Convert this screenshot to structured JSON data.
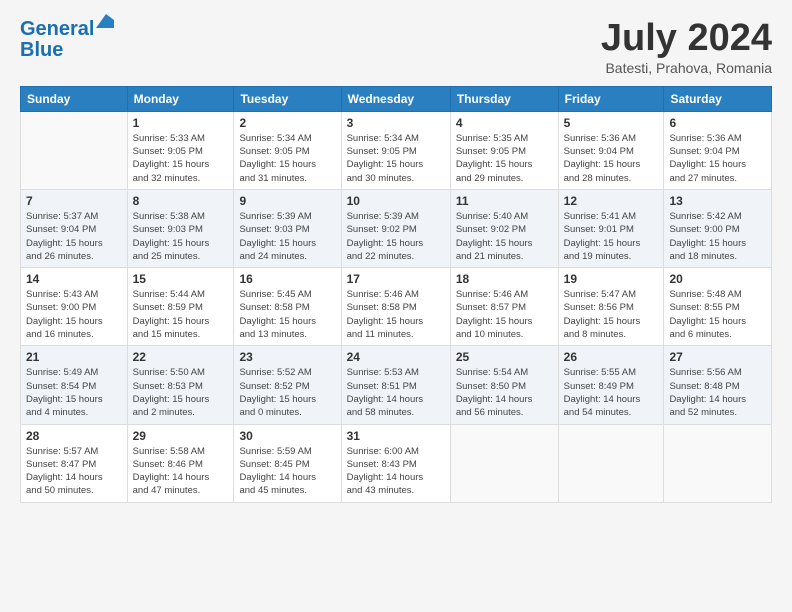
{
  "header": {
    "logo_line1": "General",
    "logo_line2": "Blue",
    "month_year": "July 2024",
    "location": "Batesti, Prahova, Romania"
  },
  "days_of_week": [
    "Sunday",
    "Monday",
    "Tuesday",
    "Wednesday",
    "Thursday",
    "Friday",
    "Saturday"
  ],
  "weeks": [
    [
      {
        "day": "",
        "info": ""
      },
      {
        "day": "1",
        "info": "Sunrise: 5:33 AM\nSunset: 9:05 PM\nDaylight: 15 hours\nand 32 minutes."
      },
      {
        "day": "2",
        "info": "Sunrise: 5:34 AM\nSunset: 9:05 PM\nDaylight: 15 hours\nand 31 minutes."
      },
      {
        "day": "3",
        "info": "Sunrise: 5:34 AM\nSunset: 9:05 PM\nDaylight: 15 hours\nand 30 minutes."
      },
      {
        "day": "4",
        "info": "Sunrise: 5:35 AM\nSunset: 9:05 PM\nDaylight: 15 hours\nand 29 minutes."
      },
      {
        "day": "5",
        "info": "Sunrise: 5:36 AM\nSunset: 9:04 PM\nDaylight: 15 hours\nand 28 minutes."
      },
      {
        "day": "6",
        "info": "Sunrise: 5:36 AM\nSunset: 9:04 PM\nDaylight: 15 hours\nand 27 minutes."
      }
    ],
    [
      {
        "day": "7",
        "info": "Sunrise: 5:37 AM\nSunset: 9:04 PM\nDaylight: 15 hours\nand 26 minutes."
      },
      {
        "day": "8",
        "info": "Sunrise: 5:38 AM\nSunset: 9:03 PM\nDaylight: 15 hours\nand 25 minutes."
      },
      {
        "day": "9",
        "info": "Sunrise: 5:39 AM\nSunset: 9:03 PM\nDaylight: 15 hours\nand 24 minutes."
      },
      {
        "day": "10",
        "info": "Sunrise: 5:39 AM\nSunset: 9:02 PM\nDaylight: 15 hours\nand 22 minutes."
      },
      {
        "day": "11",
        "info": "Sunrise: 5:40 AM\nSunset: 9:02 PM\nDaylight: 15 hours\nand 21 minutes."
      },
      {
        "day": "12",
        "info": "Sunrise: 5:41 AM\nSunset: 9:01 PM\nDaylight: 15 hours\nand 19 minutes."
      },
      {
        "day": "13",
        "info": "Sunrise: 5:42 AM\nSunset: 9:00 PM\nDaylight: 15 hours\nand 18 minutes."
      }
    ],
    [
      {
        "day": "14",
        "info": "Sunrise: 5:43 AM\nSunset: 9:00 PM\nDaylight: 15 hours\nand 16 minutes."
      },
      {
        "day": "15",
        "info": "Sunrise: 5:44 AM\nSunset: 8:59 PM\nDaylight: 15 hours\nand 15 minutes."
      },
      {
        "day": "16",
        "info": "Sunrise: 5:45 AM\nSunset: 8:58 PM\nDaylight: 15 hours\nand 13 minutes."
      },
      {
        "day": "17",
        "info": "Sunrise: 5:46 AM\nSunset: 8:58 PM\nDaylight: 15 hours\nand 11 minutes."
      },
      {
        "day": "18",
        "info": "Sunrise: 5:46 AM\nSunset: 8:57 PM\nDaylight: 15 hours\nand 10 minutes."
      },
      {
        "day": "19",
        "info": "Sunrise: 5:47 AM\nSunset: 8:56 PM\nDaylight: 15 hours\nand 8 minutes."
      },
      {
        "day": "20",
        "info": "Sunrise: 5:48 AM\nSunset: 8:55 PM\nDaylight: 15 hours\nand 6 minutes."
      }
    ],
    [
      {
        "day": "21",
        "info": "Sunrise: 5:49 AM\nSunset: 8:54 PM\nDaylight: 15 hours\nand 4 minutes."
      },
      {
        "day": "22",
        "info": "Sunrise: 5:50 AM\nSunset: 8:53 PM\nDaylight: 15 hours\nand 2 minutes."
      },
      {
        "day": "23",
        "info": "Sunrise: 5:52 AM\nSunset: 8:52 PM\nDaylight: 15 hours\nand 0 minutes."
      },
      {
        "day": "24",
        "info": "Sunrise: 5:53 AM\nSunset: 8:51 PM\nDaylight: 14 hours\nand 58 minutes."
      },
      {
        "day": "25",
        "info": "Sunrise: 5:54 AM\nSunset: 8:50 PM\nDaylight: 14 hours\nand 56 minutes."
      },
      {
        "day": "26",
        "info": "Sunrise: 5:55 AM\nSunset: 8:49 PM\nDaylight: 14 hours\nand 54 minutes."
      },
      {
        "day": "27",
        "info": "Sunrise: 5:56 AM\nSunset: 8:48 PM\nDaylight: 14 hours\nand 52 minutes."
      }
    ],
    [
      {
        "day": "28",
        "info": "Sunrise: 5:57 AM\nSunset: 8:47 PM\nDaylight: 14 hours\nand 50 minutes."
      },
      {
        "day": "29",
        "info": "Sunrise: 5:58 AM\nSunset: 8:46 PM\nDaylight: 14 hours\nand 47 minutes."
      },
      {
        "day": "30",
        "info": "Sunrise: 5:59 AM\nSunset: 8:45 PM\nDaylight: 14 hours\nand 45 minutes."
      },
      {
        "day": "31",
        "info": "Sunrise: 6:00 AM\nSunset: 8:43 PM\nDaylight: 14 hours\nand 43 minutes."
      },
      {
        "day": "",
        "info": ""
      },
      {
        "day": "",
        "info": ""
      },
      {
        "day": "",
        "info": ""
      }
    ]
  ]
}
